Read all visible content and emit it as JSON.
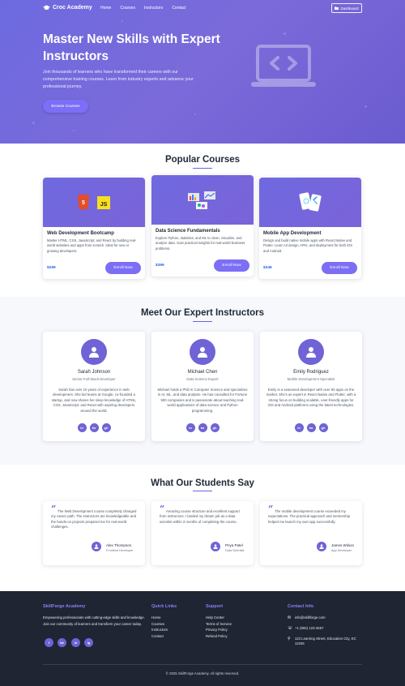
{
  "nav": {
    "brand": "Croc Academy",
    "links": [
      "Home",
      "Courses",
      "Instructors",
      "Contact"
    ],
    "dashboard_label": "Dashboard"
  },
  "hero": {
    "title": "Master New Skills with Expert Instructors",
    "subtitle": "Join thousands of learners who have transformed their careers with our comprehensive training courses. Learn from industry experts and advance your professional journey.",
    "button_label": "Browse Courses"
  },
  "courses": {
    "title": "Popular Courses",
    "items": [
      {
        "title": "Web Development Bootcamp",
        "description": "Master HTML, CSS, JavaScript, and React by building real-world websites and apps from scratch. Ideal for new or growing developers.",
        "price": "$299",
        "button": "Enroll Now"
      },
      {
        "title": "Data Science Fundamentals",
        "description": "Explore Python, statistics, and ML to clean, visualize, and analyze data. Gain practical insights for real-world business problems.",
        "price": "$399",
        "button": "Enroll Now"
      },
      {
        "title": "Mobile App Development",
        "description": "Design and build native mobile apps with React Native and Flutter. Learn UI design, APIs, and deployment for both iOS and Android.",
        "price": "$349",
        "button": "Enroll Now"
      }
    ]
  },
  "instructors": {
    "title": "Meet Our Expert Instructors",
    "items": [
      {
        "name": "Sarah Johnson",
        "role": "Senior Full-Stack Developer",
        "bio": "Sarah has over 10 years of experience in web development. She led teams at Google, co-founded a startup, and now shares her deep knowledge of HTML, CSS, JavaScript, and React with aspiring developers around the world."
      },
      {
        "name": "Michael Chen",
        "role": "Data Science Expert",
        "bio": "Michael holds a PhD in Computer Science and specializes in AI, ML, and data analysis. He has consulted for Fortune 500 companies and is passionate about teaching real-world applications of data science and Python programming."
      },
      {
        "name": "Emily Rodriguez",
        "role": "Mobile Development Specialist",
        "bio": "Emily is a seasoned developer with over 50 apps on the market. She's an expert in React Native and Flutter, with a strong focus on building scalable, user-friendly apps for iOS and Android platforms using the latest technologies."
      }
    ],
    "social": [
      "in",
      "tw",
      "gh"
    ]
  },
  "testimonials": {
    "title": "What Our Students Say",
    "items": [
      {
        "text": "The Web Development course completely changed my career path. The instructors are knowledgeable and the hands-on projects prepared me for real-world challenges.",
        "name": "Alex Thompson",
        "role": "Frontend Developer"
      },
      {
        "text": "Amazing course structure and excellent support from instructors. I landed my dream job as a data scientist within 3 months of completing the course.",
        "name": "Priya Patel",
        "role": "Data Scientist"
      },
      {
        "text": "The mobile development course exceeded my expectations. The practical approach and mentorship helped me launch my own app successfully.",
        "name": "James Wilson",
        "role": "App Developer"
      }
    ]
  },
  "footer": {
    "brand": "SkillForge Academy",
    "about": "Empowering professionals with cutting-edge skills and knowledge. Join our community of learners and transform your career today.",
    "social": [
      "f",
      "tw",
      "in",
      "ig"
    ],
    "quick_links_title": "Quick Links",
    "quick_links": [
      "Home",
      "Courses",
      "Instructors",
      "Contact"
    ],
    "support_title": "Support",
    "support_links": [
      "Help Center",
      "Terms of Service",
      "Privacy Policy",
      "Refund Policy"
    ],
    "contact_title": "Contact Info",
    "email": "info@skillforge.com",
    "phone": "+1 (555) 123-4567",
    "address": "123 Learning Street, Education City, EC 12345",
    "copyright": "© 2025 SkillForge Academy. All rights reserved."
  },
  "colors": {
    "accent": "#6f63d6",
    "hero_gradient_start": "#6d6ae0",
    "footer_bg": "#1f2533",
    "price": "#2563eb"
  }
}
